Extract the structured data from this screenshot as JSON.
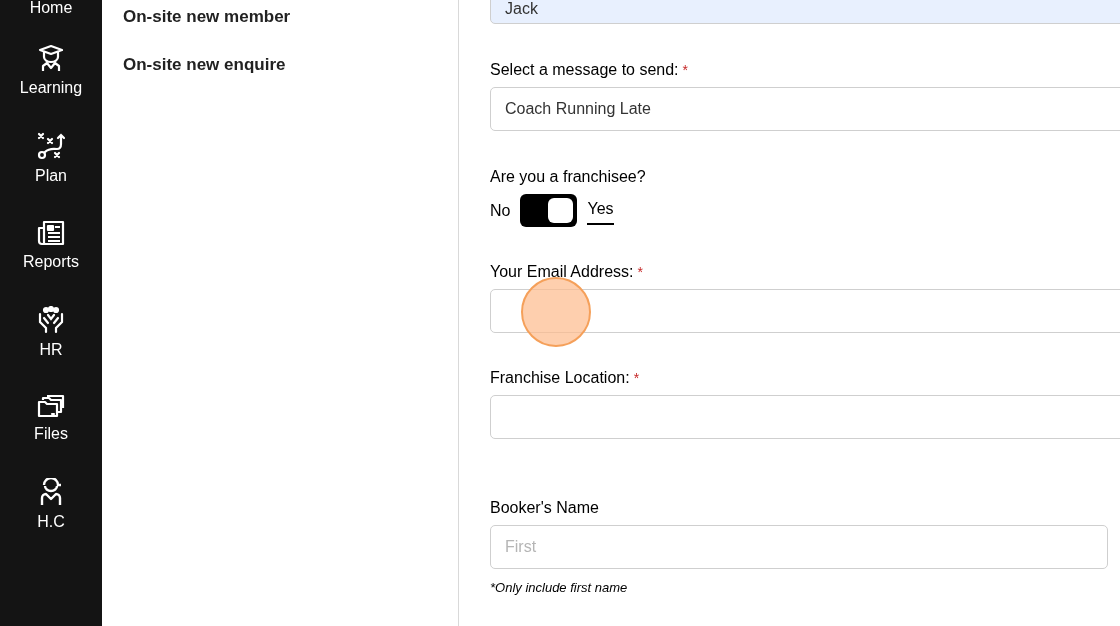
{
  "sidebar": {
    "items": [
      {
        "label": "Home"
      },
      {
        "label": "Learning"
      },
      {
        "label": "Plan"
      },
      {
        "label": "Reports"
      },
      {
        "label": "HR"
      },
      {
        "label": "Files"
      },
      {
        "label": "H.C"
      }
    ]
  },
  "menu": {
    "items": [
      "On-site new member",
      "On-site new enquire"
    ]
  },
  "form": {
    "fields": [
      {
        "kind": "text",
        "value": "Jack",
        "autofilled": true
      },
      {
        "kind": "select",
        "label": "Select a message to send:",
        "required_mark": "*",
        "value": "Coach Running Late"
      },
      {
        "kind": "toggle",
        "label": "Are you a franchisee?",
        "off_label": "No",
        "on_label": "Yes",
        "on": true
      },
      {
        "kind": "text",
        "label": "Your Email Address:",
        "required_mark": "*",
        "click_marker": true
      },
      {
        "kind": "text",
        "label": "Franchise Location:",
        "required_mark": "*"
      },
      {
        "kind": "text",
        "label": "Booker's Name",
        "placeholder": "First",
        "note": "*Only include first name",
        "narrow": true
      }
    ]
  }
}
